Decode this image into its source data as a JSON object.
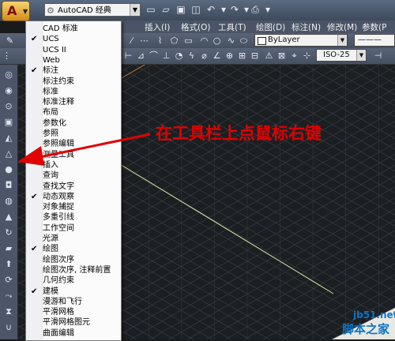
{
  "workspace": {
    "value": "AutoCAD 经典"
  },
  "menubar": {
    "items": [
      "插入(I)",
      "格式(O)",
      "工具(T)",
      "绘图(D)",
      "标注(N)",
      "修改(M)",
      "参数(P"
    ]
  },
  "toolbar1": {
    "linetype": "ByLayer"
  },
  "toolbar2": {
    "dimstyle": "ISO-25"
  },
  "context_menu": {
    "items": [
      {
        "label": "CAD 标准",
        "checked": false
      },
      {
        "label": "UCS",
        "checked": true
      },
      {
        "label": "UCS II",
        "checked": false
      },
      {
        "label": "Web",
        "checked": false
      },
      {
        "label": "标注",
        "checked": true
      },
      {
        "label": "标注约束",
        "checked": false
      },
      {
        "label": "标准",
        "checked": false
      },
      {
        "label": "标准注释",
        "checked": false
      },
      {
        "label": "布局",
        "checked": false
      },
      {
        "label": "参数化",
        "checked": false
      },
      {
        "label": "参照",
        "checked": false
      },
      {
        "label": "参照编辑",
        "checked": false
      },
      {
        "label": "测量工具",
        "checked": false
      },
      {
        "label": "插入",
        "checked": false
      },
      {
        "label": "查询",
        "checked": false
      },
      {
        "label": "查找文字",
        "checked": false
      },
      {
        "label": "动态观察",
        "checked": true
      },
      {
        "label": "对象捕捉",
        "checked": false
      },
      {
        "label": "多重引线",
        "checked": false
      },
      {
        "label": "工作空间",
        "checked": false
      },
      {
        "label": "光源",
        "checked": false
      },
      {
        "label": "绘图",
        "checked": true
      },
      {
        "label": "绘图次序",
        "checked": false
      },
      {
        "label": "绘图次序, 注释前置",
        "checked": false
      },
      {
        "label": "几何约束",
        "checked": false
      },
      {
        "label": "建模",
        "checked": true
      },
      {
        "label": "漫游和飞行",
        "checked": false
      },
      {
        "label": "平滑网格",
        "checked": false
      },
      {
        "label": "平滑网格图元",
        "checked": false
      },
      {
        "label": "曲面编辑",
        "checked": false
      }
    ],
    "check_glyph": "✔"
  },
  "annotation": {
    "text": "在工具栏上点鼠标右键",
    "color": "#e00000"
  },
  "watermark": {
    "url": "jb51.net",
    "text": "脚本之家",
    "color": "#0b74c4"
  },
  "colors": {
    "canvas": "#1c1f22",
    "grid": "#3b4048",
    "menu_bg": "#fbfbfb"
  }
}
